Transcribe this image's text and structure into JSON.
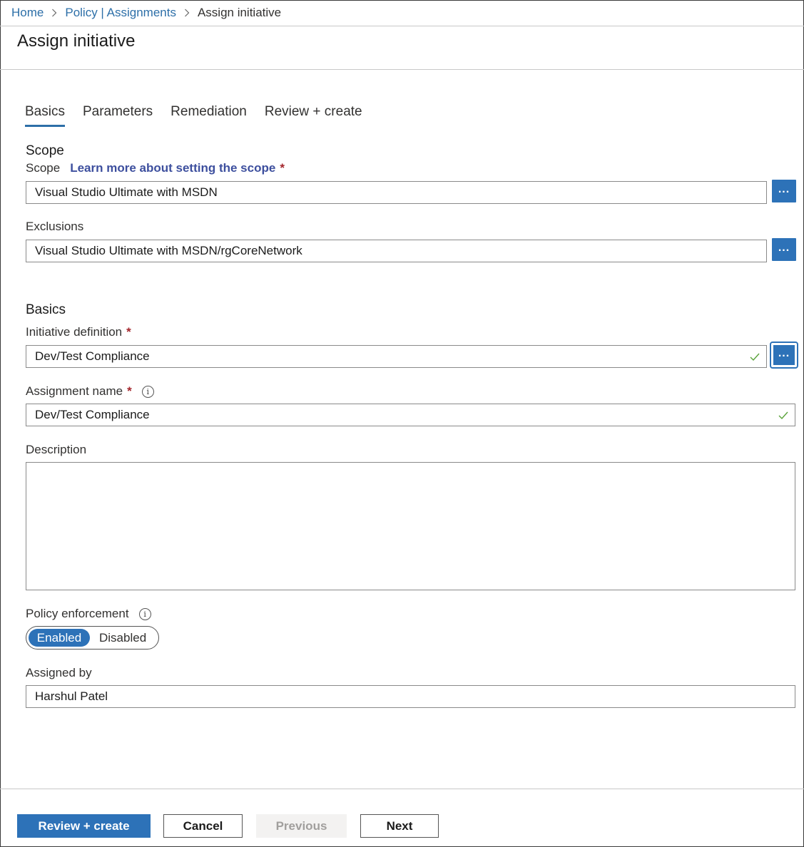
{
  "breadcrumb": {
    "items": [
      {
        "label": "Home"
      },
      {
        "label": "Policy | Assignments"
      },
      {
        "label": "Assign initiative"
      }
    ]
  },
  "page": {
    "title": "Assign initiative"
  },
  "tabs": [
    {
      "label": "Basics",
      "active": true
    },
    {
      "label": "Parameters",
      "active": false
    },
    {
      "label": "Remediation",
      "active": false
    },
    {
      "label": "Review + create",
      "active": false
    }
  ],
  "scope_section": {
    "heading": "Scope",
    "scope_label": "Scope",
    "scope_link": "Learn more about setting the scope",
    "required_mark": "*",
    "scope_value": "Visual Studio Ultimate with MSDN",
    "exclusions_label": "Exclusions",
    "exclusions_value": "Visual Studio Ultimate with MSDN/rgCoreNetwork",
    "browse_label": "..."
  },
  "basics_section": {
    "heading": "Basics",
    "initiative_label": "Initiative definition",
    "initiative_value": "Dev/Test Compliance",
    "assignment_label": "Assignment name",
    "assignment_value": "Dev/Test Compliance",
    "description_label": "Description",
    "description_value": "",
    "enforcement_label": "Policy enforcement",
    "enforcement_on": "Enabled",
    "enforcement_off": "Disabled",
    "enforcement_selected": "Enabled",
    "assigned_by_label": "Assigned by",
    "assigned_by_value": "Harshul Patel",
    "info_glyph": "i"
  },
  "footer": {
    "review_create": "Review + create",
    "cancel": "Cancel",
    "previous": "Previous",
    "next": "Next"
  },
  "colors": {
    "accent": "#2d72b8",
    "link": "#2d6fa8",
    "required": "#a4262c",
    "valid_check": "#5aa33a"
  },
  "icons": [
    "chevron-right-icon",
    "info-icon",
    "checkmark-icon",
    "ellipsis-icon"
  ]
}
